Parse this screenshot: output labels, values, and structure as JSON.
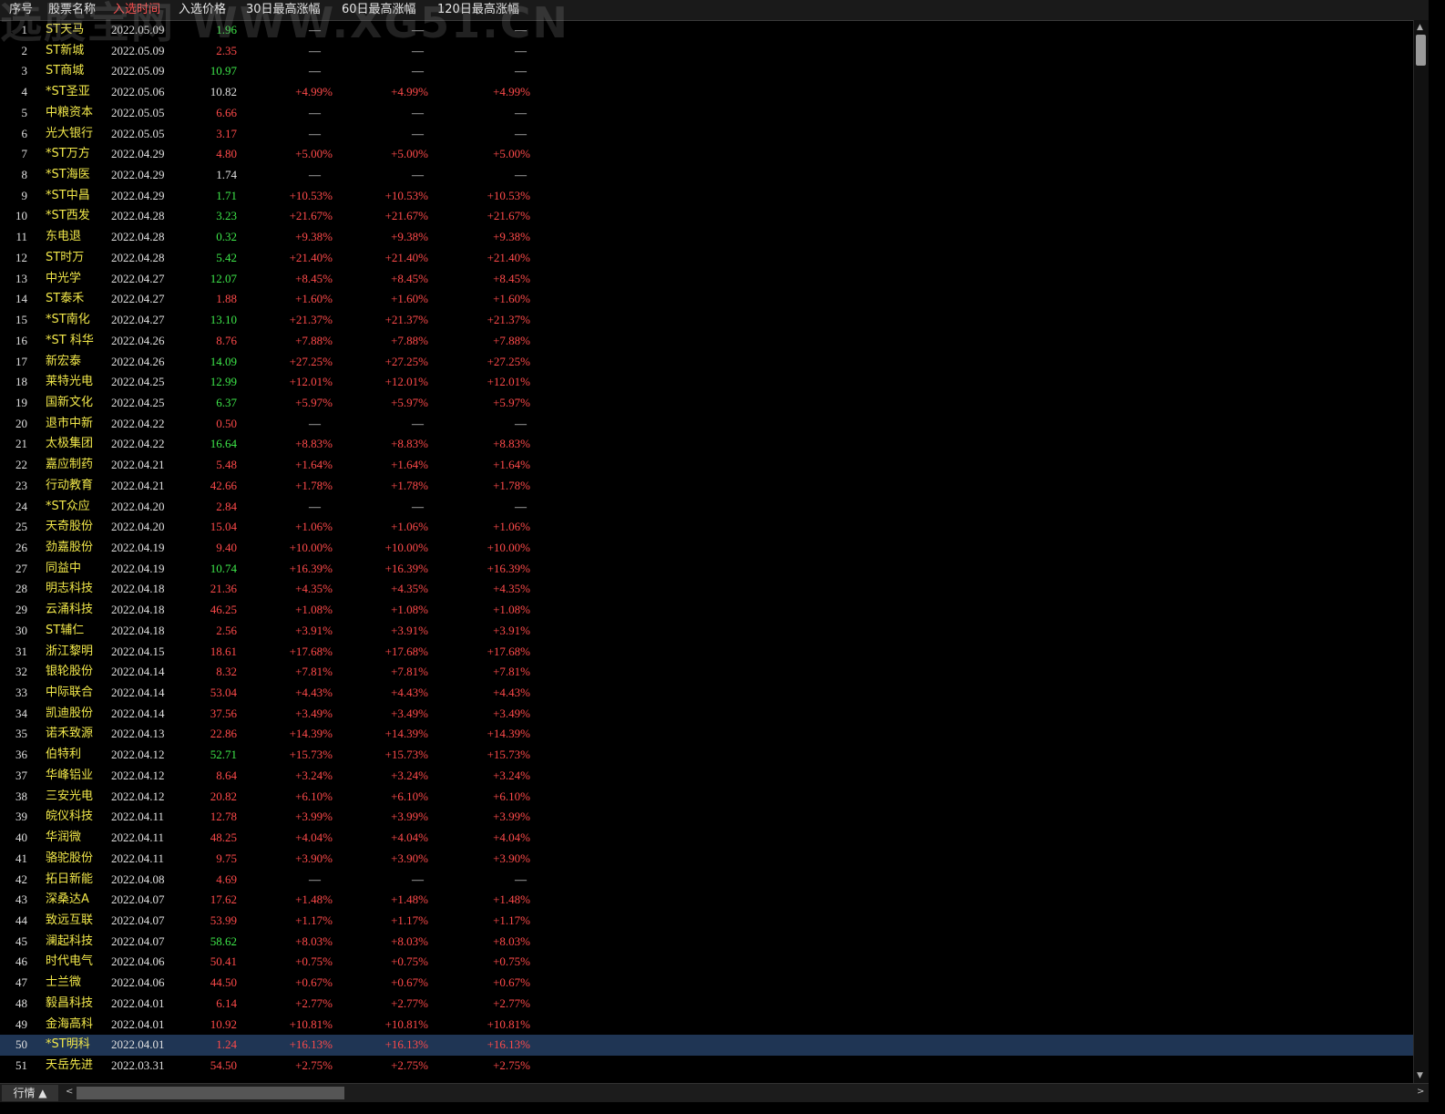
{
  "watermark": "选股宝网 WWW.XG51.CN",
  "header": {
    "cols": [
      "序号",
      "股票名称",
      "入选时间",
      "入选价格",
      "30日最高涨幅",
      "60日最高涨幅",
      "120日最高涨幅"
    ],
    "active_col": 2
  },
  "rows": [
    [
      "1",
      "ST天马",
      "2022.05.09",
      "1.96",
      "down",
      "—",
      "—",
      "—"
    ],
    [
      "2",
      "ST新城",
      "2022.05.09",
      "2.35",
      "up",
      "—",
      "—",
      "—"
    ],
    [
      "3",
      "ST商城",
      "2022.05.09",
      "10.97",
      "down",
      "—",
      "—",
      "—"
    ],
    [
      "4",
      "*ST圣亚",
      "2022.05.06",
      "10.82",
      "flat",
      "+4.99%",
      "+4.99%",
      "+4.99%"
    ],
    [
      "5",
      "中粮资本",
      "2022.05.05",
      "6.66",
      "up",
      "—",
      "—",
      "—"
    ],
    [
      "6",
      "光大银行",
      "2022.05.05",
      "3.17",
      "up",
      "—",
      "—",
      "—"
    ],
    [
      "7",
      "*ST万方",
      "2022.04.29",
      "4.80",
      "up",
      "+5.00%",
      "+5.00%",
      "+5.00%"
    ],
    [
      "8",
      "*ST海医",
      "2022.04.29",
      "1.74",
      "flat",
      "—",
      "—",
      "—"
    ],
    [
      "9",
      "*ST中昌",
      "2022.04.29",
      "1.71",
      "down",
      "+10.53%",
      "+10.53%",
      "+10.53%"
    ],
    [
      "10",
      "*ST西发",
      "2022.04.28",
      "3.23",
      "down",
      "+21.67%",
      "+21.67%",
      "+21.67%"
    ],
    [
      "11",
      "东电退",
      "2022.04.28",
      "0.32",
      "down",
      "+9.38%",
      "+9.38%",
      "+9.38%"
    ],
    [
      "12",
      "ST时万",
      "2022.04.28",
      "5.42",
      "down",
      "+21.40%",
      "+21.40%",
      "+21.40%"
    ],
    [
      "13",
      "中光学",
      "2022.04.27",
      "12.07",
      "down",
      "+8.45%",
      "+8.45%",
      "+8.45%"
    ],
    [
      "14",
      "ST泰禾",
      "2022.04.27",
      "1.88",
      "up",
      "+1.60%",
      "+1.60%",
      "+1.60%"
    ],
    [
      "15",
      "*ST南化",
      "2022.04.27",
      "13.10",
      "down",
      "+21.37%",
      "+21.37%",
      "+21.37%"
    ],
    [
      "16",
      "*ST 科华",
      "2022.04.26",
      "8.76",
      "up",
      "+7.88%",
      "+7.88%",
      "+7.88%"
    ],
    [
      "17",
      "新宏泰",
      "2022.04.26",
      "14.09",
      "down",
      "+27.25%",
      "+27.25%",
      "+27.25%"
    ],
    [
      "18",
      "莱特光电",
      "2022.04.25",
      "12.99",
      "down",
      "+12.01%",
      "+12.01%",
      "+12.01%"
    ],
    [
      "19",
      "国新文化",
      "2022.04.25",
      "6.37",
      "down",
      "+5.97%",
      "+5.97%",
      "+5.97%"
    ],
    [
      "20",
      "退市中新",
      "2022.04.22",
      "0.50",
      "up",
      "—",
      "—",
      "—"
    ],
    [
      "21",
      "太极集团",
      "2022.04.22",
      "16.64",
      "down",
      "+8.83%",
      "+8.83%",
      "+8.83%"
    ],
    [
      "22",
      "嘉应制药",
      "2022.04.21",
      "5.48",
      "up",
      "+1.64%",
      "+1.64%",
      "+1.64%"
    ],
    [
      "23",
      "行动教育",
      "2022.04.21",
      "42.66",
      "up",
      "+1.78%",
      "+1.78%",
      "+1.78%"
    ],
    [
      "24",
      "*ST众应",
      "2022.04.20",
      "2.84",
      "up",
      "—",
      "—",
      "—"
    ],
    [
      "25",
      "天奇股份",
      "2022.04.20",
      "15.04",
      "up",
      "+1.06%",
      "+1.06%",
      "+1.06%"
    ],
    [
      "26",
      "劲嘉股份",
      "2022.04.19",
      "9.40",
      "up",
      "+10.00%",
      "+10.00%",
      "+10.00%"
    ],
    [
      "27",
      "同益中",
      "2022.04.19",
      "10.74",
      "down",
      "+16.39%",
      "+16.39%",
      "+16.39%"
    ],
    [
      "28",
      "明志科技",
      "2022.04.18",
      "21.36",
      "up",
      "+4.35%",
      "+4.35%",
      "+4.35%"
    ],
    [
      "29",
      "云涌科技",
      "2022.04.18",
      "46.25",
      "up",
      "+1.08%",
      "+1.08%",
      "+1.08%"
    ],
    [
      "30",
      "ST辅仁",
      "2022.04.18",
      "2.56",
      "up",
      "+3.91%",
      "+3.91%",
      "+3.91%"
    ],
    [
      "31",
      "浙江黎明",
      "2022.04.15",
      "18.61",
      "up",
      "+17.68%",
      "+17.68%",
      "+17.68%"
    ],
    [
      "32",
      "银轮股份",
      "2022.04.14",
      "8.32",
      "up",
      "+7.81%",
      "+7.81%",
      "+7.81%"
    ],
    [
      "33",
      "中际联合",
      "2022.04.14",
      "53.04",
      "up",
      "+4.43%",
      "+4.43%",
      "+4.43%"
    ],
    [
      "34",
      "凯迪股份",
      "2022.04.14",
      "37.56",
      "up",
      "+3.49%",
      "+3.49%",
      "+3.49%"
    ],
    [
      "35",
      "诺禾致源",
      "2022.04.13",
      "22.86",
      "up",
      "+14.39%",
      "+14.39%",
      "+14.39%"
    ],
    [
      "36",
      "伯特利",
      "2022.04.12",
      "52.71",
      "down",
      "+15.73%",
      "+15.73%",
      "+15.73%"
    ],
    [
      "37",
      "华峰铝业",
      "2022.04.12",
      "8.64",
      "up",
      "+3.24%",
      "+3.24%",
      "+3.24%"
    ],
    [
      "38",
      "三安光电",
      "2022.04.12",
      "20.82",
      "up",
      "+6.10%",
      "+6.10%",
      "+6.10%"
    ],
    [
      "39",
      "皖仪科技",
      "2022.04.11",
      "12.78",
      "up",
      "+3.99%",
      "+3.99%",
      "+3.99%"
    ],
    [
      "40",
      "华润微",
      "2022.04.11",
      "48.25",
      "up",
      "+4.04%",
      "+4.04%",
      "+4.04%"
    ],
    [
      "41",
      "骆驼股份",
      "2022.04.11",
      "9.75",
      "up",
      "+3.90%",
      "+3.90%",
      "+3.90%"
    ],
    [
      "42",
      "拓日新能",
      "2022.04.08",
      "4.69",
      "up",
      "—",
      "—",
      "—"
    ],
    [
      "43",
      "深桑达A",
      "2022.04.07",
      "17.62",
      "up",
      "+1.48%",
      "+1.48%",
      "+1.48%"
    ],
    [
      "44",
      "致远互联",
      "2022.04.07",
      "53.99",
      "up",
      "+1.17%",
      "+1.17%",
      "+1.17%"
    ],
    [
      "45",
      "澜起科技",
      "2022.04.07",
      "58.62",
      "down",
      "+8.03%",
      "+8.03%",
      "+8.03%"
    ],
    [
      "46",
      "时代电气",
      "2022.04.06",
      "50.41",
      "up",
      "+0.75%",
      "+0.75%",
      "+0.75%"
    ],
    [
      "47",
      "士兰微",
      "2022.04.06",
      "44.50",
      "up",
      "+0.67%",
      "+0.67%",
      "+0.67%"
    ],
    [
      "48",
      "毅昌科技",
      "2022.04.01",
      "6.14",
      "up",
      "+2.77%",
      "+2.77%",
      "+2.77%"
    ],
    [
      "49",
      "金海高科",
      "2022.04.01",
      "10.92",
      "up",
      "+10.81%",
      "+10.81%",
      "+10.81%"
    ],
    [
      "50",
      "*ST明科",
      "2022.04.01",
      "1.24",
      "up",
      "+16.13%",
      "+16.13%",
      "+16.13%"
    ],
    [
      "51",
      "天岳先进",
      "2022.03.31",
      "54.50",
      "up",
      "+2.75%",
      "+2.75%",
      "+2.75%"
    ]
  ],
  "selected_row": 50,
  "bottom": {
    "tab_label": "行情 ▲",
    "left_arrow": "<",
    "right_arrow": ">"
  },
  "vscroll": {
    "up_arrow": "▲",
    "down_arrow": "▼"
  },
  "colors": {
    "up": "#ff4a4a",
    "down": "#3ee84a",
    "name": "#f2e84a",
    "selected_bg": "#1f3554"
  }
}
